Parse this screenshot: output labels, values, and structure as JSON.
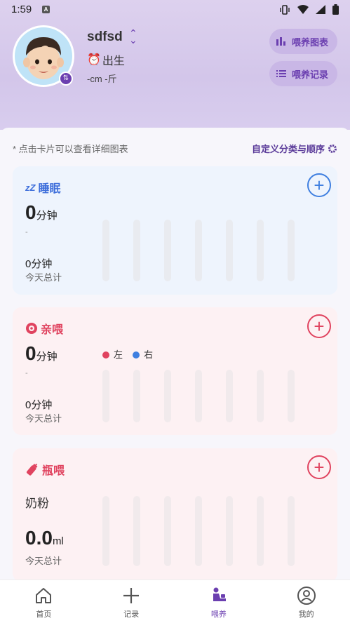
{
  "status": {
    "time": "1:59"
  },
  "profile": {
    "name": "sdfsd",
    "stage": "出生",
    "measure": "-cm -斤"
  },
  "actions": {
    "chart_label": "喂养图表",
    "record_label": "喂养记录"
  },
  "hint": "* 点击卡片可以查看详细图表",
  "custom_label": "自定义分类与顺序",
  "cards": {
    "sleep": {
      "title": "睡眠",
      "value": "0",
      "unit": "分钟",
      "sub": "-",
      "total_value": "0分钟",
      "total_label": "今天总计",
      "accent": "#3f6fdb"
    },
    "nurse": {
      "title": "亲喂",
      "value": "0",
      "unit": "分钟",
      "sub": "-",
      "legend_left": "左",
      "legend_right": "右",
      "total_value": "0分钟",
      "total_label": "今天总计",
      "accent": "#e0435f"
    },
    "bottle": {
      "title": "瓶喂",
      "milk_type": "奶粉",
      "value": "0.0",
      "unit": "ml",
      "total_label": "今天总计",
      "accent": "#e0435f"
    }
  },
  "tabs": [
    {
      "label": "首页",
      "icon": "home-icon"
    },
    {
      "label": "记录",
      "icon": "plus-icon"
    },
    {
      "label": "喂养",
      "icon": "feeding-icon"
    },
    {
      "label": "我的",
      "icon": "user-icon"
    }
  ],
  "colors": {
    "brand": "#6b3fb0",
    "left_dot": "#e0435f",
    "right_dot": "#3f7fe0"
  }
}
